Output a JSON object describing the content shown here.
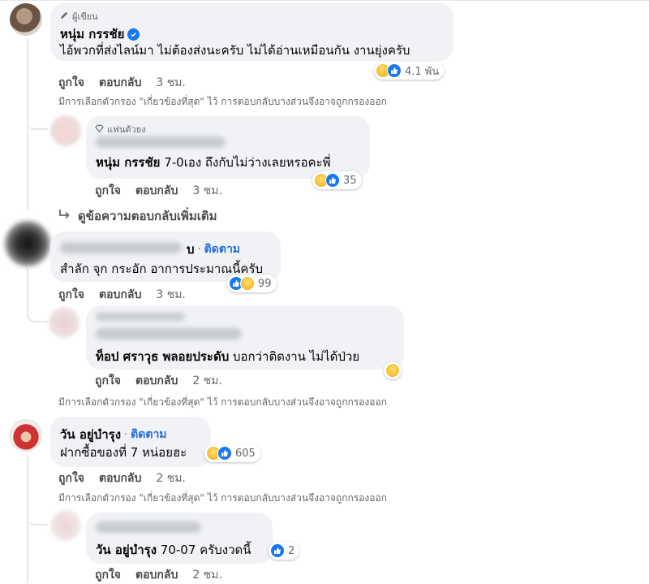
{
  "thread": {
    "c1": {
      "badge": "ผู้เขียน",
      "name": "หนุ่ม กรรชัย",
      "text": "ไอ้พวกที่ส่งไลน์มา ไม่ต้องส่งนะครับ ไม่ได้อ่านเหมือนกัน งานยุ่งครับ",
      "reaction_count": "4.1 พัน",
      "like": "ถูกใจ",
      "reply": "ตอบกลับ",
      "time": "3 ชม.",
      "filter_note": "มีการเลือกตัวกรอง \"เกี่ยวข้องที่สุด\" ไว้ การตอบกลับบางส่วนจึงอาจถูกกรองออก"
    },
    "c2": {
      "badge": "แฟนตัวยง",
      "mention": "หนุ่ม กรรชัย",
      "text": " 7-0เอง ถึงกับไม่ว่างเลยหรอคะพี่",
      "reaction_count": "35",
      "like": "ถูกใจ",
      "reply": "ตอบกลับ",
      "time": "3 ชม."
    },
    "view_more": "ดูข้อความตอบกลับเพิ่มเติม",
    "c3": {
      "name_tail": "บ",
      "follow": "ติดตาม",
      "text": "สำลัก จุก กระอัก อาการประมาณนี้ครับ",
      "reaction_count": "99",
      "like": "ถูกใจ",
      "reply": "ตอบกลับ",
      "time": "3 ชม."
    },
    "c4": {
      "mention": "ท็อป ศราวุธ พลอยประดับ",
      "text": " บอกว่าติดงาน ไม่ได้ป่วย",
      "like": "ถูกใจ",
      "reply": "ตอบกลับ",
      "time": "2 ชม.",
      "filter_note": "มีการเลือกตัวกรอง \"เกี่ยวข้องที่สุด\" ไว้ การตอบกลับบางส่วนจึงอาจถูกกรองออก"
    },
    "c5": {
      "name": "วัน อยู่บำรุง",
      "follow": "ติดตาม",
      "text": "ฝากซื้อของที่ 7 หน่อยฮะ",
      "reaction_count": "605",
      "like": "ถูกใจ",
      "reply": "ตอบกลับ",
      "time": "2 ชม.",
      "filter_note": "มีการเลือกตัวกรอง \"เกี่ยวข้องที่สุด\" ไว้ การตอบกลับบางส่วนจึงอาจถูกกรองออก"
    },
    "c6": {
      "mention": "วัน อยู่บำรุง",
      "text": " 70-07 ครับงวดนี้",
      "reaction_count": "2",
      "like": "ถูกใจ",
      "reply": "ตอบกลับ",
      "time": "2 ชม."
    }
  },
  "icons": {
    "haha": "haha-reaction-icon",
    "like": "like-reaction-icon",
    "verified": "verified-badge-icon",
    "author": "pencil-icon",
    "fan": "diamond-icon",
    "reply_arrow": "reply-arrow-icon"
  },
  "colors": {
    "link": "#216fdb",
    "like_blue": "#1877f2",
    "bubble": "#f0f2f5",
    "meta": "#65676b"
  }
}
